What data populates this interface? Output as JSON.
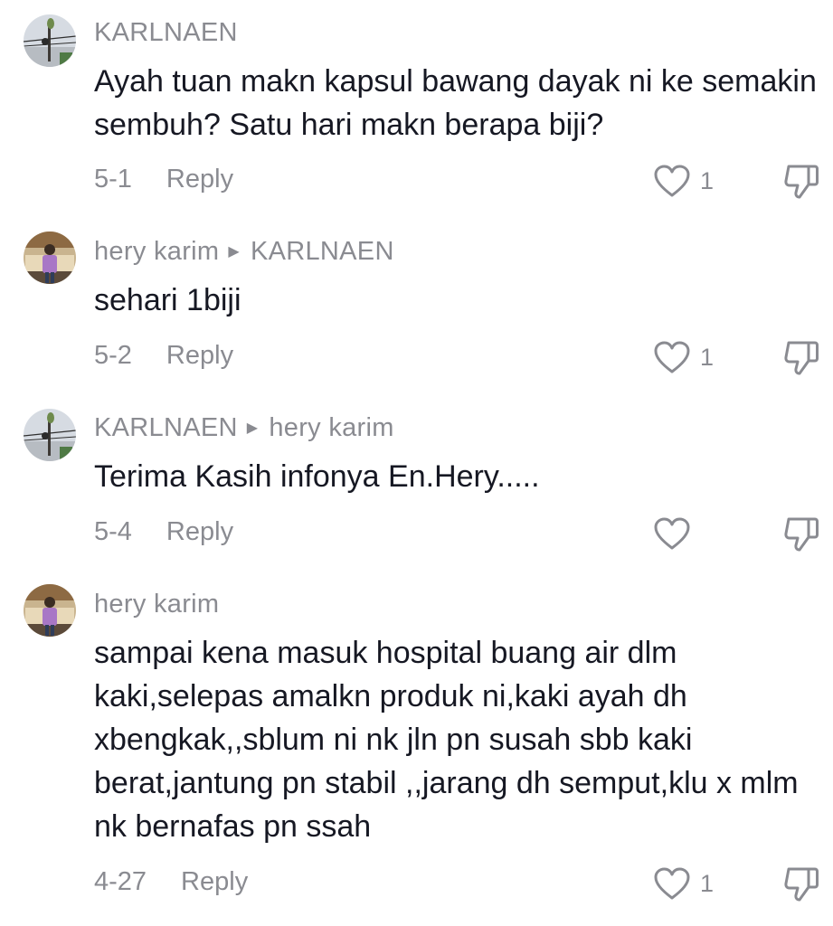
{
  "comments": [
    {
      "author": "KARLNAEN",
      "reply_to": "",
      "text": "Ayah tuan makn kapsul bawang dayak ni ke semakin sembuh? Satu hari makn berapa biji?",
      "date": "5-1",
      "reply_label": "Reply",
      "likes": "1",
      "avatar": "pole-avatar"
    },
    {
      "author": "hery karim",
      "reply_to": "KARLNAEN",
      "text": "sehari 1biji",
      "date": "5-2",
      "reply_label": "Reply",
      "likes": "1",
      "avatar": "person-avatar"
    },
    {
      "author": "KARLNAEN",
      "reply_to": "hery karim",
      "text": "Terima Kasih infonya En.Hery.....",
      "date": "5-4",
      "reply_label": "Reply",
      "likes": "",
      "avatar": "pole-avatar"
    },
    {
      "author": "hery karim",
      "reply_to": "",
      "text": "sampai kena masuk hospital buang air dlm kaki,selepas amalkn produk ni,kaki ayah dh xbengkak,,sblum ni nk jln pn susah sbb kaki berat,jantung pn stabil ,,jarang dh semput,klu x mlm nk bernafas pn ssah",
      "date": "4-27",
      "reply_label": "Reply",
      "likes": "1",
      "avatar": "person-avatar"
    }
  ],
  "icons": {
    "like": "heart-outline-icon",
    "dislike": "thumbs-down-outline-icon",
    "reply_arrow": "triangle-right-icon"
  },
  "colors": {
    "primary_text": "#161823",
    "secondary_text": "#8a8b91",
    "background": "#ffffff"
  }
}
